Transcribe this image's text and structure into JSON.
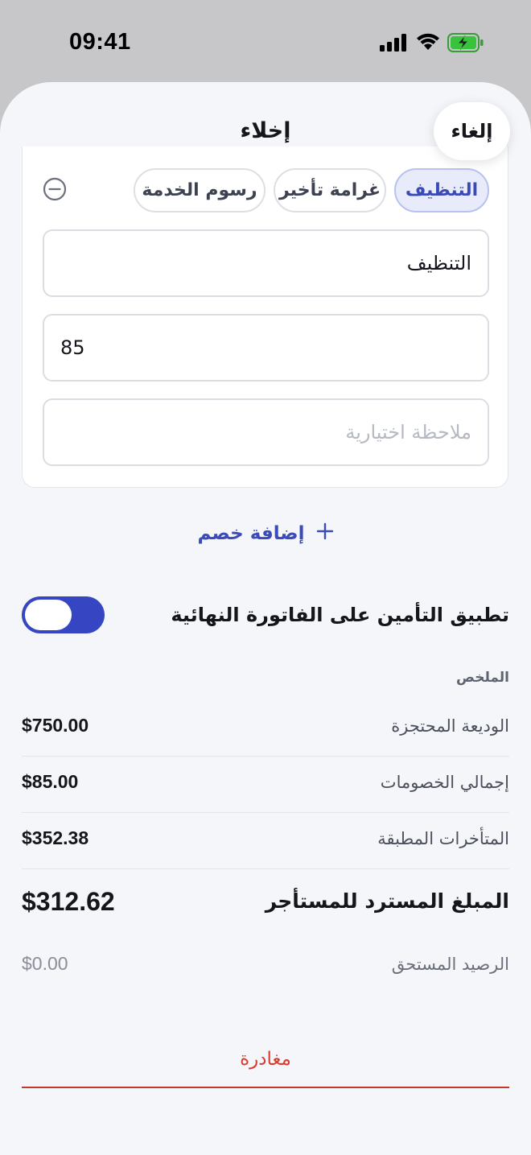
{
  "status_bar": {
    "time": "09:41"
  },
  "header": {
    "title": "إخلاء",
    "cancel_label": "إلغاء"
  },
  "deduction": {
    "chips": [
      {
        "label": "التنظيف",
        "selected": true
      },
      {
        "label": "غرامة تأخير",
        "selected": false
      },
      {
        "label": "رسوم الخدمة",
        "selected": false
      }
    ],
    "name_value": "التنظيف",
    "amount_value": "85",
    "note_placeholder": "ملاحظة اختيارية"
  },
  "add_deduction_label": "إضافة خصم",
  "insurance_toggle": {
    "label": "تطبيق التأمين على الفاتورة النهائية",
    "on": true
  },
  "summary": {
    "title": "الملخص",
    "rows": [
      {
        "label": "الوديعة المحتجزة",
        "value": "$750.00"
      },
      {
        "label": "إجمالي الخصومات",
        "value": "$85.00"
      },
      {
        "label": "المتأخرات المطبقة",
        "value": "$352.38"
      }
    ],
    "refund_label": "المبلغ المسترد للمستأجر",
    "refund_value": "$312.62",
    "balance_label": "الرصيد المستحق",
    "balance_value": "$0.00"
  },
  "leave_label": "مغادرة",
  "colors": {
    "accent": "#3646c2",
    "danger": "#d63c31"
  }
}
